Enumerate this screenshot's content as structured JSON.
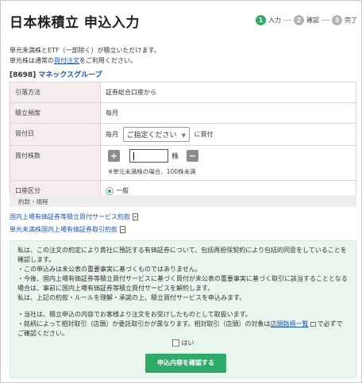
{
  "page": {
    "title": "日本株積立 申込入力"
  },
  "steps": [
    {
      "num": "1",
      "label": "入力"
    },
    {
      "num": "2",
      "label": "確認"
    },
    {
      "num": "3",
      "label": "完了"
    }
  ],
  "intro": {
    "line1": "単元未満株とETF（一部除く）が積立いただけます。",
    "line2_prefix": "単元株は通常の",
    "line2_link": "買付注文",
    "line2_suffix": "をご利用ください。"
  },
  "security": {
    "code": "[8698]",
    "name": "マネックスグループ"
  },
  "form": {
    "withdrawal_label": "引落方法",
    "withdrawal_value": "証券総合口座から",
    "frequency_label": "積立頻度",
    "frequency_value": "毎月",
    "buy_day_label": "買付日",
    "buy_day_prefix": "毎月",
    "buy_day_select": "ご指定ください",
    "buy_day_suffix": "に買付",
    "qty_label": "買付株数",
    "qty_minus": "+",
    "qty_plus": "−",
    "qty_unit": "株",
    "qty_note": "※単元未満株の場合、100株未満",
    "account_label": "口座区分",
    "account_value": "一般"
  },
  "docs": {
    "band_title": "約款・規程",
    "link1": "国内上場有価証券等積立買付サービス約款",
    "link2": "単元未満株国内上場有価証券取引約款"
  },
  "terms": {
    "p1": "私は、この注文の約定により貴社に預託する有価証券について、包括再担保契約により包括的同意をしていることを確認します。",
    "p2": "・この申込みは未公表の重要事実に基づくものではありません。",
    "p3": "・今後、国内上場有価証券等積立買付サービスに基づく買付が未公表の重要事実に基づく取引に該当することとなる場合は、事前に国内上場有価証券等積立買付サービスを解約します。",
    "p4": "私は、上記の約款・ルールを理解・承諾の上、積立買付サービスを申込みます。",
    "p5": "・当社は、積立申込の内容でお客様より注文をお受けしたものとして取扱います。",
    "p6_prefix": "・銘柄によって相対取引（店頭）か委託取引かが異なります。相対取引（店頭）の対象は",
    "p6_link": "店頭銘柄一覧",
    "p6_suffix": "でご確認ください。",
    "p6_suffix_pre": "で必ず",
    "agree_label": "はい",
    "confirm_button": "申込内容を確認する"
  }
}
